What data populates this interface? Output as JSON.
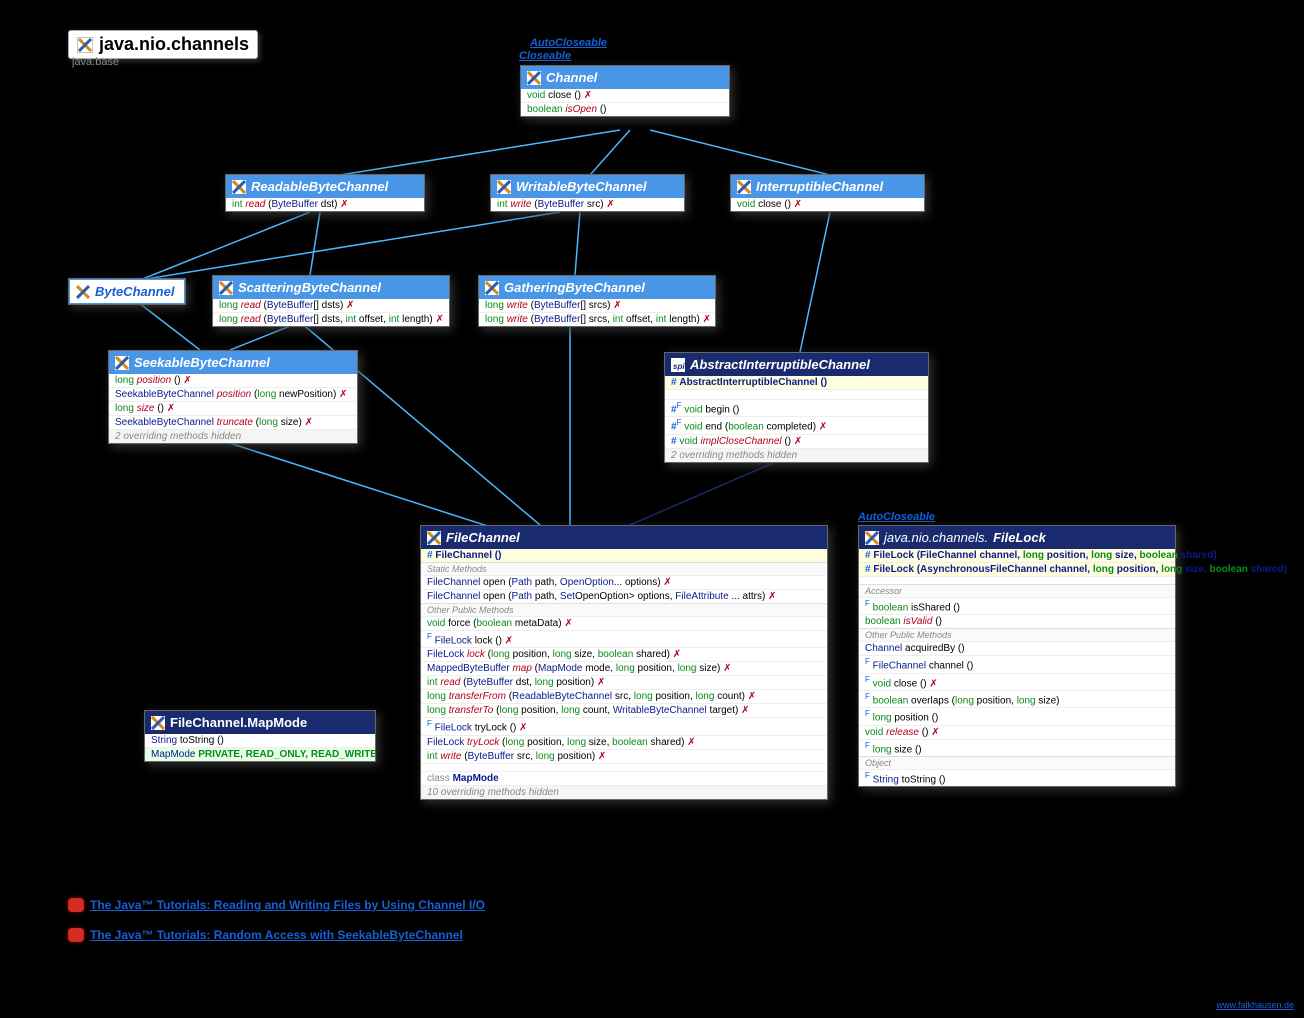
{
  "package": {
    "name": "java.nio.channels",
    "module": "java.base"
  },
  "supers": {
    "auto": "AutoCloseable",
    "close": "Closeable"
  },
  "classes": {
    "channel": {
      "title": "Channel",
      "rows": [
        {
          "ret": "void",
          "name": "close",
          "sig": "()",
          "exc": true
        },
        {
          "ret": "boolean",
          "name": "isOpen",
          "sig": "()",
          "it": true
        }
      ]
    },
    "readable": {
      "title": "ReadableByteChannel",
      "rows": [
        {
          "ret": "int",
          "name": "read",
          "sig": "(ByteBuffer dst)",
          "exc": true,
          "nit": true
        }
      ]
    },
    "writable": {
      "title": "WritableByteChannel",
      "rows": [
        {
          "ret": "int",
          "name": "write",
          "sig": "(ByteBuffer src)",
          "exc": true,
          "nit": true
        }
      ]
    },
    "interruptible": {
      "title": "InterruptibleChannel",
      "rows": [
        {
          "ret": "void",
          "name": "close",
          "sig": "()",
          "exc": true
        }
      ]
    },
    "bytech": {
      "title": "ByteChannel"
    },
    "scattering": {
      "title": "ScatteringByteChannel",
      "rows": [
        {
          "ret": "long",
          "name": "read",
          "sig": "(ByteBuffer[] dsts)",
          "exc": true,
          "nit": true
        },
        {
          "ret": "long",
          "name": "read",
          "sig": "(ByteBuffer[] dsts, int offset, int length)",
          "exc": true,
          "nit": true
        }
      ]
    },
    "gathering": {
      "title": "GatheringByteChannel",
      "rows": [
        {
          "ret": "long",
          "name": "write",
          "sig": "(ByteBuffer[] srcs)",
          "exc": true,
          "nit": true
        },
        {
          "ret": "long",
          "name": "write",
          "sig": "(ByteBuffer[] srcs, int offset, int length)",
          "exc": true,
          "nit": true
        }
      ]
    },
    "seekable": {
      "title": "SeekableByteChannel",
      "rows": [
        {
          "ret": "long",
          "name": "position",
          "sig": "()",
          "exc": true,
          "nit": true
        },
        {
          "ret": "SeekableByteChannel",
          "name": "position",
          "sig": "(long newPosition)",
          "exc": true,
          "nit": true
        },
        {
          "ret": "long",
          "name": "size",
          "sig": "()",
          "exc": true,
          "nit": true
        },
        {
          "ret": "SeekableByteChannel",
          "name": "truncate",
          "sig": "(long size)",
          "exc": true,
          "nit": true
        }
      ],
      "hidden": "2 overriding methods hidden"
    },
    "abstractint": {
      "title": "AbstractInterruptibleChannel",
      "ctor": "AbstractInterruptibleChannel ()",
      "rows": [
        {
          "pre": "#",
          "flag": "F",
          "ret": "void",
          "name": "begin",
          "sig": "()"
        },
        {
          "pre": "#",
          "flag": "F",
          "ret": "void",
          "name": "end",
          "sig": "(boolean completed)",
          "exc": true
        },
        {
          "pre": "#",
          "ret": "void",
          "name": "implCloseChannel",
          "sig": "()",
          "exc": true,
          "nit": true
        }
      ],
      "hidden": "2 overriding methods hidden"
    },
    "filechannel": {
      "title": "FileChannel",
      "ctor": "FileChannel ()",
      "static_label": "Static Methods",
      "static": [
        {
          "ret": "FileChannel",
          "name": "open",
          "sig": "(Path path, OpenOption... options)",
          "exc": true
        },
        {
          "ret": "FileChannel",
          "name": "open",
          "sig": "(Path path, Set<? extends OpenOption> options, FileAttribute <?>... attrs)",
          "exc": true,
          "wrap": true
        }
      ],
      "other_label": "Other Public Methods",
      "rows": [
        {
          "ret": "void",
          "name": "force",
          "sig": "(boolean metaData)",
          "exc": true
        },
        {
          "flag": "F",
          "ret": "FileLock",
          "name": "lock",
          "sig": "()",
          "exc": true
        },
        {
          "ret": "FileLock",
          "name": "lock",
          "sig": "(long position, long size, boolean shared)",
          "exc": true,
          "nit": true
        },
        {
          "ret": "MappedByteBuffer",
          "name": "map",
          "sig": "(MapMode mode, long position, long size)",
          "exc": true,
          "nit": true
        },
        {
          "ret": "int",
          "name": "read",
          "sig": "(ByteBuffer dst, long position)",
          "exc": true,
          "nit": true
        },
        {
          "ret": "long",
          "name": "transferFrom",
          "sig": "(ReadableByteChannel src, long position, long count)",
          "exc": true,
          "nit": true
        },
        {
          "ret": "long",
          "name": "transferTo",
          "sig": "(long position, long count, WritableByteChannel target)",
          "exc": true,
          "nit": true
        },
        {
          "flag": "F",
          "ret": "FileLock",
          "name": "tryLock",
          "sig": "()",
          "exc": true
        },
        {
          "ret": "FileLock",
          "name": "tryLock",
          "sig": "(long position, long size, boolean shared)",
          "exc": true,
          "nit": true
        },
        {
          "ret": "int",
          "name": "write",
          "sig": "(ByteBuffer src, long position)",
          "exc": true,
          "nit": true
        }
      ],
      "inner": "class MapMode",
      "hidden": "10 overriding methods hidden"
    },
    "mapmode": {
      "title": "FileChannel.MapMode",
      "rows": [
        {
          "ret": "String",
          "name": "toString",
          "sig": "()"
        }
      ],
      "consts_label": "MapMode",
      "consts": "PRIVATE, READ_ONLY, READ_WRITE"
    },
    "filelock": {
      "pkg": "java.nio.channels.",
      "title": "FileLock",
      "ctors": [
        "FileLock (FileChannel channel, long position, long size, boolean shared)",
        "FileLock (AsynchronousFileChannel channel, long position, long size, boolean shared)"
      ],
      "acc_label": "Accessor",
      "acc": [
        {
          "flag": "F",
          "ret": "boolean",
          "name": "isShared",
          "sig": "()"
        },
        {
          "ret": "boolean",
          "name": "isValid",
          "sig": "()",
          "it": true
        }
      ],
      "other_label": "Other Public Methods",
      "rows": [
        {
          "ret": "Channel",
          "name": "acquiredBy",
          "sig": "()"
        },
        {
          "flag": "F",
          "ret": "FileChannel",
          "name": "channel",
          "sig": "()"
        },
        {
          "flag": "F",
          "ret": "void",
          "name": "close",
          "sig": "()",
          "exc": true
        },
        {
          "flag": "F",
          "ret": "boolean",
          "name": "overlaps",
          "sig": "(long position, long size)"
        },
        {
          "flag": "F",
          "ret": "long",
          "name": "position",
          "sig": "()"
        },
        {
          "ret": "void",
          "name": "release",
          "sig": "()",
          "exc": true,
          "nit": true
        },
        {
          "flag": "F",
          "ret": "long",
          "name": "size",
          "sig": "()"
        }
      ],
      "obj_label": "Object",
      "obj": [
        {
          "flag": "F",
          "ret": "String",
          "name": "toString",
          "sig": "()"
        }
      ]
    }
  },
  "links": {
    "a": "The Java™ Tutorials: Reading and Writing Files by Using Channel I/O",
    "b": "The Java™ Tutorials: Random Access with SeekableByteChannel"
  },
  "attrib": "www.falkhausen.de"
}
